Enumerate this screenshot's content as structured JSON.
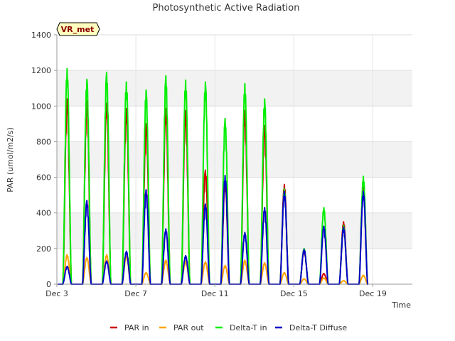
{
  "chart_data": {
    "type": "line",
    "title": "Photosynthetic Active Radiation",
    "xlabel": "Time",
    "ylabel": "PAR (umol/m2/s)",
    "site_badge": "VR_met",
    "ylim": [
      0,
      1400
    ],
    "xlim": [
      0,
      18
    ],
    "yticks": [
      0,
      200,
      400,
      600,
      800,
      1000,
      1200,
      1400
    ],
    "xticks": [
      {
        "day": 0,
        "label": "Dec 3"
      },
      {
        "day": 4,
        "label": "Dec 7"
      },
      {
        "day": 8,
        "label": "Dec 11"
      },
      {
        "day": 12,
        "label": "Dec 15"
      },
      {
        "day": 16,
        "label": "Dec 19"
      }
    ],
    "grid": true,
    "legend_position": "bottom",
    "day_start_hours": 7.2,
    "day_length_hours": 10.5,
    "series": [
      {
        "name": "PAR in",
        "color": "#cc0000",
        "daily_peaks": [
          1040,
          1030,
          1015,
          985,
          900,
          985,
          975,
          640,
          570,
          975,
          890,
          560,
          190,
          60,
          350,
          580
        ]
      },
      {
        "name": "PAR out",
        "color": "#ffa500",
        "daily_peaks": [
          165,
          150,
          165,
          160,
          65,
          135,
          130,
          125,
          105,
          135,
          120,
          65,
          30,
          35,
          20,
          50
        ]
      },
      {
        "name": "Delta-T in",
        "color": "#00ee00",
        "daily_peaks": [
          1210,
          1150,
          1190,
          1135,
          1090,
          1170,
          1145,
          1135,
          930,
          1125,
          1040,
          535,
          200,
          430,
          330,
          605
        ]
      },
      {
        "name": "Delta-T Diffuse",
        "color": "#0000cc",
        "daily_peaks": [
          100,
          470,
          130,
          185,
          530,
          310,
          160,
          450,
          610,
          290,
          430,
          520,
          195,
          325,
          320,
          520
        ]
      }
    ]
  }
}
